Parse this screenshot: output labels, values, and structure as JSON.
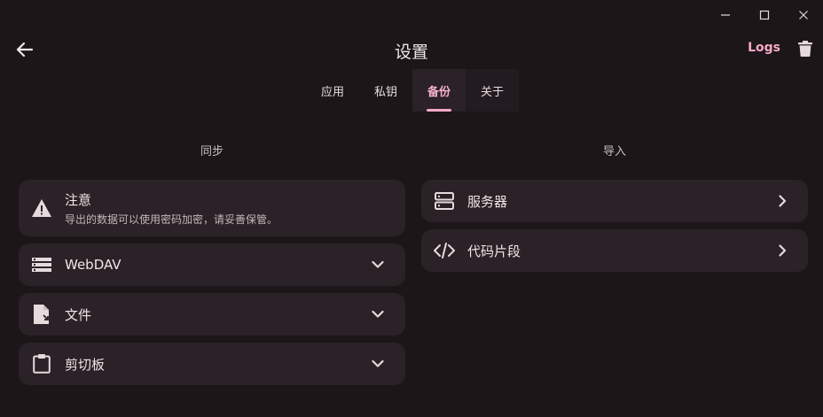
{
  "window": {
    "minimize_icon": "minimize-icon",
    "maximize_icon": "maximize-icon",
    "close_icon": "close-icon"
  },
  "header": {
    "title": "设置",
    "logs_label": "Logs"
  },
  "tabs": [
    {
      "label": "应用",
      "active": false
    },
    {
      "label": "私钥",
      "active": false
    },
    {
      "label": "备份",
      "active": true
    },
    {
      "label": "关于",
      "active": false
    }
  ],
  "sync": {
    "section_title": "同步",
    "notice": {
      "title": "注意",
      "text": "导出的数据可以使用密码加密，请妥善保管。"
    },
    "items": [
      {
        "label": "WebDAV",
        "icon": "storage-list-icon"
      },
      {
        "label": "文件",
        "icon": "file-export-icon"
      },
      {
        "label": "剪切板",
        "icon": "clipboard-icon"
      }
    ]
  },
  "import": {
    "section_title": "导入",
    "items": [
      {
        "label": "服务器",
        "icon": "server-icon"
      },
      {
        "label": "代码片段",
        "icon": "code-icon"
      }
    ]
  },
  "colors": {
    "background": "#1c1619",
    "card": "#2a2226",
    "accent": "#f7a9c7"
  }
}
